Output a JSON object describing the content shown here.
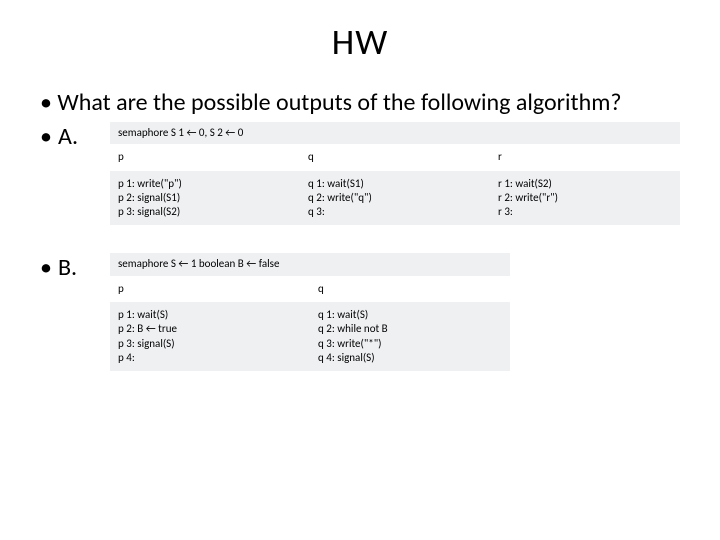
{
  "title": "HW",
  "question": "• What are the possible outputs of the following algorithm?",
  "bullet": "•",
  "labelA": "A.",
  "labelB": "B.",
  "tableA": {
    "init": "semaphore S 1 ← 0, S 2 ← 0",
    "headers": {
      "p": "p",
      "q": "q",
      "r": "r"
    },
    "p": "p 1: write(\"p\")\np 2: signal(S1)\np 3: signal(S2)",
    "q": "q 1: wait(S1)\nq 2: write(\"q\")\nq 3:",
    "r": "r 1: wait(S2)\nr 2: write(\"r\")\nr 3:"
  },
  "tableB": {
    "init": "semaphore S ← 1 boolean B ← false",
    "headers": {
      "p": "p",
      "q": "q"
    },
    "p": "p 1: wait(S)\np 2: B ← true\np 3: signal(S)\np 4:",
    "q": "q 1: wait(S)\nq 2: while not B\nq 3: write(\"*\")\nq 4: signal(S)"
  }
}
